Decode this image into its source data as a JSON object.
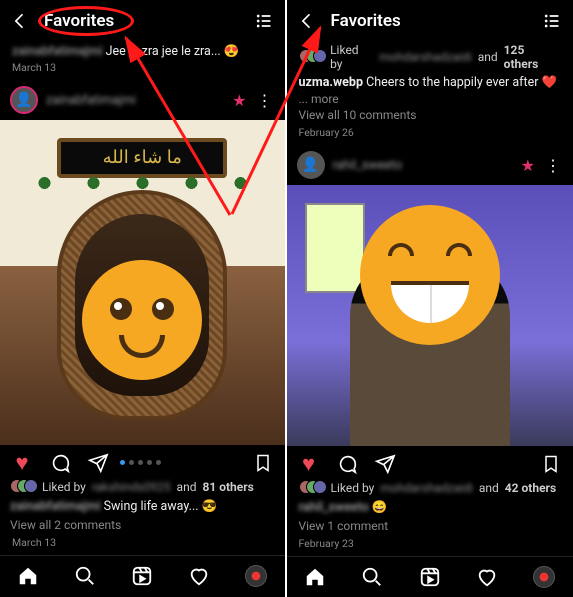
{
  "left": {
    "header": {
      "title": "Favorites"
    },
    "post1": {
      "caption_user": "zainabfatimajmi",
      "caption_text": "Jee le zra jee le zra... 😍",
      "date": "March 13"
    },
    "post2_header": {
      "username": "zainabfatimajmi",
      "plaque_text": "ما شاء الله"
    },
    "actions": {
      "liked_prefix": "Liked by",
      "liked_by_blur": "rakshinds0925",
      "liked_and": "and",
      "liked_count": "81 others",
      "caption_user": "zainabfatimajmi",
      "caption_text": "Swing life away... 😎",
      "view_comments": "View all 2 comments",
      "date2": "March 13"
    }
  },
  "right": {
    "header": {
      "title": "Favorites"
    },
    "top_post": {
      "liked_prefix": "Liked by",
      "liked_by_blur": "mohdarshadzaidi",
      "liked_and": "and",
      "liked_count": "125 others",
      "caption_user": "uzma.webp",
      "caption_text": "Cheers to the happily ever after",
      "more": "... more",
      "view_comments": "View all 10 comments",
      "date": "February 26"
    },
    "post_header": {
      "username": "rahil_sweeto"
    },
    "bottom": {
      "liked_prefix": "Liked by",
      "liked_by_blur": "mohdarshadzaidi",
      "liked_and": "and",
      "liked_count": "42 others",
      "caption_user": "rahil_sweeto",
      "caption_emoji": "😄",
      "view_comments": "View 1 comment",
      "date": "February 23"
    }
  },
  "colors": {
    "accent_red": "#ed4956",
    "annotation_red": "#ff1a1a"
  }
}
